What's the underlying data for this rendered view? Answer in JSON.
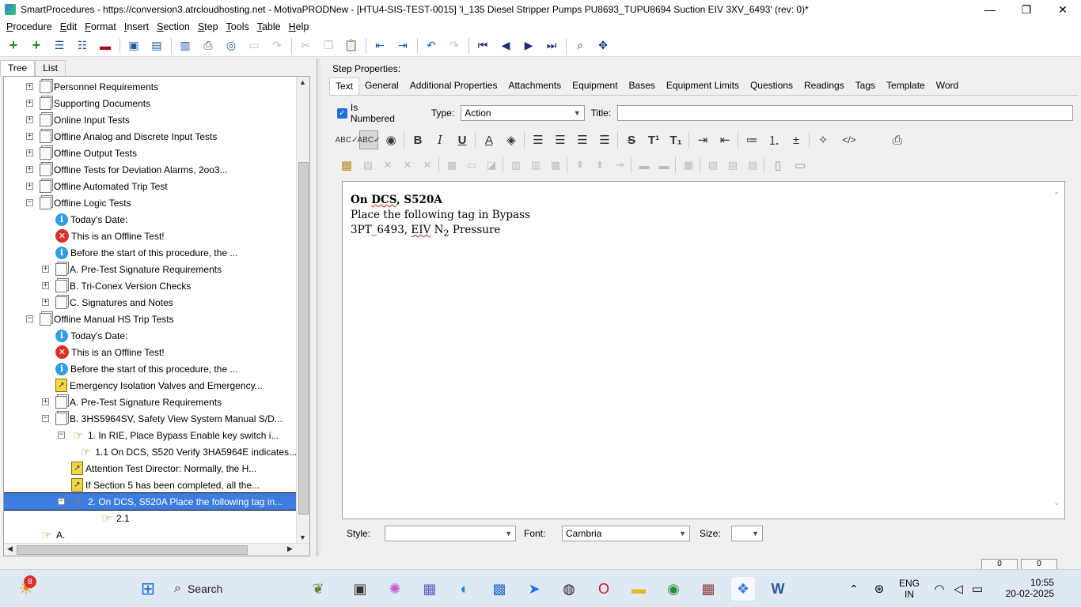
{
  "window": {
    "title": "SmartProcedures - https://conversion3.atrcloudhosting.net - MotivaPRODNew - [HTU4-SIS-TEST-0015] 'I_135 Diesel Stripper Pumps PU8693_TUPU8694 Suction EIV 3XV_6493' (rev: 0)*",
    "minimize": "—",
    "maximize": "❐",
    "close": "✕"
  },
  "menu": [
    "Procedure",
    "Edit",
    "Format",
    "Insert",
    "Section",
    "Step",
    "Tools",
    "Table",
    "Help"
  ],
  "left_tabs": [
    "Tree",
    "List"
  ],
  "tree": [
    {
      "level": 0,
      "exp": "+",
      "icon": "doc",
      "label": "Personnel Requirements"
    },
    {
      "level": 0,
      "exp": "+",
      "icon": "doc",
      "label": "Supporting Documents"
    },
    {
      "level": 0,
      "exp": "+",
      "icon": "doc",
      "label": "Online Input Tests"
    },
    {
      "level": 0,
      "exp": "+",
      "icon": "doc",
      "label": "Offline Analog and Discrete Input Tests"
    },
    {
      "level": 0,
      "exp": "+",
      "icon": "doc",
      "label": "Offline Output Tests"
    },
    {
      "level": 0,
      "exp": "+",
      "icon": "doc",
      "label": "Offline Tests for Deviation Alarms, 2oo3..."
    },
    {
      "level": 0,
      "exp": "+",
      "icon": "doc",
      "label": "Offline Automated Trip Test"
    },
    {
      "level": 0,
      "exp": "−",
      "icon": "doc",
      "label": "Offline Logic Tests"
    },
    {
      "level": 1,
      "exp": "",
      "icon": "info",
      "label": "Today's Date:"
    },
    {
      "level": 1,
      "exp": "",
      "icon": "err",
      "label": "This is an Offline Test!"
    },
    {
      "level": 1,
      "exp": "",
      "icon": "info",
      "label": "Before the start of this procedure, the ..."
    },
    {
      "level": 1,
      "exp": "+",
      "icon": "doc",
      "label": "A. Pre-Test Signature Requirements"
    },
    {
      "level": 1,
      "exp": "+",
      "icon": "doc",
      "label": "B. Tri-Conex Version Checks"
    },
    {
      "level": 1,
      "exp": "+",
      "icon": "doc",
      "label": "C. Signatures and Notes"
    },
    {
      "level": 0,
      "exp": "−",
      "icon": "doc",
      "label": "Offline Manual HS Trip Tests"
    },
    {
      "level": 1,
      "exp": "",
      "icon": "info",
      "label": "Today's Date:"
    },
    {
      "level": 1,
      "exp": "",
      "icon": "err",
      "label": "This is an Offline Test!"
    },
    {
      "level": 1,
      "exp": "",
      "icon": "info",
      "label": "Before the start of this procedure, the ..."
    },
    {
      "level": 1,
      "exp": "",
      "icon": "warn",
      "label": "Emergency Isolation Valves and Emergency..."
    },
    {
      "level": 1,
      "exp": "+",
      "icon": "doc",
      "label": "A. Pre-Test Signature Requirements"
    },
    {
      "level": 1,
      "exp": "−",
      "icon": "doc",
      "label": "B. 3HS5964SV, Safety View System Manual S/D..."
    },
    {
      "level": 2,
      "exp": "−",
      "icon": "hand",
      "label": "1. In RIE, Place Bypass Enable key switch i..."
    },
    {
      "level": 3,
      "exp": "",
      "icon": "hand",
      "label": "1.1 On DCS, S520 Verify 3HA5964E indicates..."
    },
    {
      "level": 2,
      "exp": "",
      "icon": "warn",
      "label": "Attention Test Director: Normally, the H..."
    },
    {
      "level": 2,
      "exp": "",
      "icon": "warn",
      "label": "If Section 5 has been completed, all the..."
    },
    {
      "level": 2,
      "exp": "−",
      "icon": "hand",
      "label": "2. On DCS, S520A Place the following tag in...",
      "selected": true
    },
    {
      "level": 3,
      "exp": "",
      "icon": "hand",
      "label": "2.1"
    },
    {
      "level": 0,
      "exp": "",
      "icon": "hand",
      "label": "A."
    }
  ],
  "step_properties_label": "Step Properties:",
  "right_tabs": [
    "Text",
    "General",
    "Additional Properties",
    "Attachments",
    "Equipment",
    "Bases",
    "Equipment Limits",
    "Questions",
    "Readings",
    "Tags",
    "Template",
    "Word"
  ],
  "is_numbered_label": "Is Numbered",
  "type_label": "Type:",
  "type_value": "Action",
  "title_label": "Title:",
  "editor": {
    "line1_a": "On ",
    "line1_b": "DCS",
    "line1_c": ", S520A",
    "line2": "Place the following tag in Bypass",
    "line3_a": "3PT_6493, ",
    "line3_b": "EIV",
    "line3_c": " N",
    "line3_sub": "2",
    "line3_d": " Pressure"
  },
  "style_label": "Style:",
  "style_value": "",
  "font_label": "Font:",
  "font_value": "Cambria",
  "size_label": "Size:",
  "size_value": "",
  "status": [
    "0",
    "0"
  ],
  "taskbar": {
    "search_placeholder": "Search",
    "badge_count": "8",
    "lang_top": "ENG",
    "lang_bottom": "IN",
    "time": "10:55",
    "date": "20-02-2025"
  }
}
